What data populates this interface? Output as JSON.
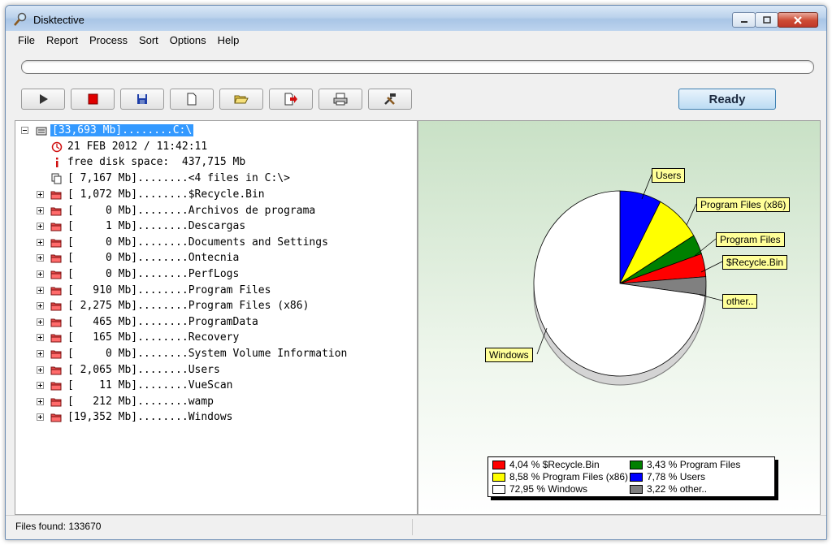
{
  "window": {
    "title": "Disktective",
    "app_icon": "magnifier-icon",
    "controls": [
      "minimize-icon",
      "maximize-icon",
      "close-icon"
    ]
  },
  "menu": [
    "File",
    "Report",
    "Process",
    "Sort",
    "Options",
    "Help"
  ],
  "progress": {
    "fraction": 0.0
  },
  "toolbar": {
    "buttons": [
      {
        "name": "play-icon"
      },
      {
        "name": "stop-icon",
        "color": "#e00000"
      },
      {
        "name": "save-icon",
        "color": "#1f3fa8"
      },
      {
        "name": "new-document-icon"
      },
      {
        "name": "open-folder-icon",
        "color": "#e8c84a"
      },
      {
        "name": "export-icon",
        "color": "#d01010"
      },
      {
        "name": "print-icon"
      },
      {
        "name": "tools-icon"
      }
    ],
    "ready_label": "Ready"
  },
  "tree": {
    "root": {
      "label": "[33,693 Mb]........C:\\",
      "icon": "drive-icon"
    },
    "date": {
      "label": "21 FEB 2012 / 11:42:11",
      "icon": "clock-icon"
    },
    "free": {
      "label": "free disk space:  437,715 Mb",
      "icon": "info-icon"
    },
    "files": {
      "label": "[ 7,167 Mb]........<4 files in C:\\>",
      "icon": "files-icon"
    },
    "folders": [
      "[ 1,072 Mb]........$Recycle.Bin",
      "[     0 Mb]........Archivos de programa",
      "[     1 Mb]........Descargas",
      "[     0 Mb]........Documents and Settings",
      "[     0 Mb]........Ontecnia",
      "[     0 Mb]........PerfLogs",
      "[   910 Mb]........Program Files",
      "[ 2,275 Mb]........Program Files (x86)",
      "[   465 Mb]........ProgramData",
      "[   165 Mb]........Recovery",
      "[     0 Mb]........System Volume Information",
      "[ 2,065 Mb]........Users",
      "[    11 Mb]........VueScan",
      "[   212 Mb]........wamp",
      "[19,352 Mb]........Windows"
    ]
  },
  "chart_data": {
    "type": "pie",
    "slices": [
      {
        "name": "Users",
        "value": 7.78,
        "color": "#0000ff"
      },
      {
        "name": "Program Files (x86)",
        "value": 8.58,
        "color": "#ffff00"
      },
      {
        "name": "Program Files",
        "value": 3.43,
        "color": "#008000"
      },
      {
        "name": "$Recycle.Bin",
        "value": 4.04,
        "color": "#ff0000"
      },
      {
        "name": "other..",
        "value": 3.22,
        "color": "#808080"
      },
      {
        "name": "Windows",
        "value": 72.95,
        "color": "#ffffff"
      }
    ],
    "legend": [
      "4,04 % $Recycle.Bin",
      "3,43 % Program Files",
      "8,58 % Program Files (x86)",
      "7,78 % Users",
      "72,95 % Windows",
      "3,22 % other.."
    ],
    "legend_colors": [
      "#ff0000",
      "#008000",
      "#ffff00",
      "#0000ff",
      "#ffffff",
      "#808080"
    ],
    "legend_placement": "bottom"
  },
  "status": {
    "text": "Files found: 133670"
  }
}
